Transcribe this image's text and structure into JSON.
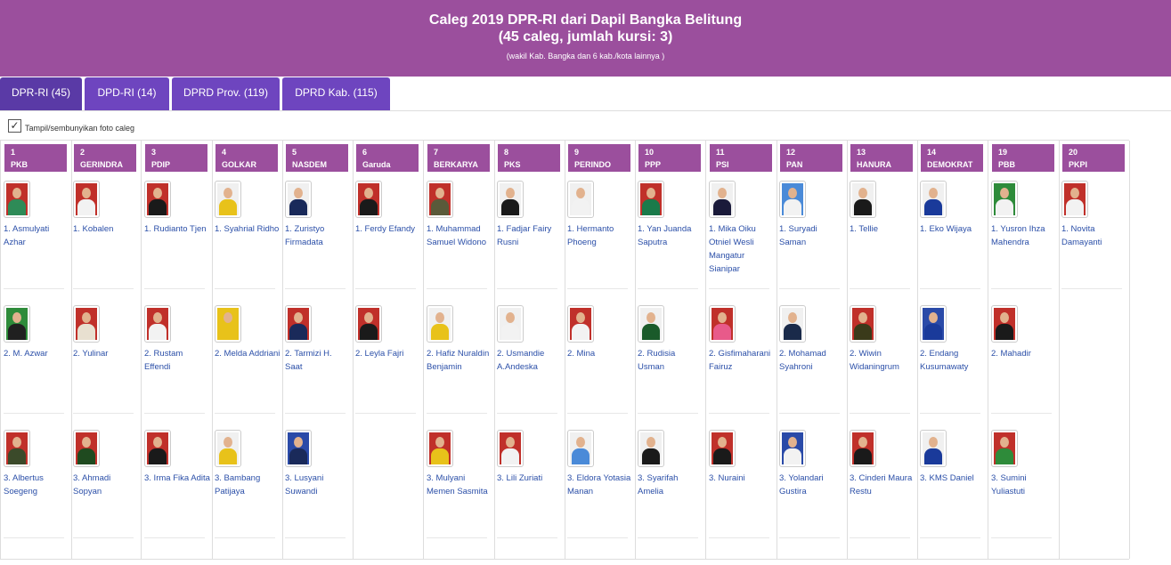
{
  "header": {
    "title_line1": "Caleg 2019 DPR-RI dari Dapil Bangka Belitung",
    "title_line2": "(45 caleg, jumlah kursi: 3)",
    "subtitle": "(wakil Kab. Bangka dan 6 kab./kota lainnya )",
    "bg_color": "#9b4f9d"
  },
  "tabs": [
    {
      "label": "DPR-RI (45)",
      "active": true
    },
    {
      "label": "DPD-RI (14)",
      "active": false
    },
    {
      "label": "DPRD Prov. (119)",
      "active": false
    },
    {
      "label": "DPRD Kab. (115)",
      "active": false
    }
  ],
  "toggle": {
    "label": "Tampil/sembunyikan foto caleg",
    "checked": true,
    "check_glyph": "✓"
  },
  "colors": {
    "party_header": "#9b4f9d",
    "tab": "#6e45bf",
    "link": "#2b4fa8"
  },
  "parties": [
    {
      "num": "1",
      "name": "PKB",
      "candidates": [
        {
          "name": "1. Asmulyati Azhar",
          "photo_bg": "#c0302a",
          "attire": "#2e8b57"
        },
        {
          "name": "2. M. Azwar",
          "photo_bg": "#2e8b3a",
          "attire": "#202020"
        },
        {
          "name": "3. Albertus Soegeng",
          "photo_bg": "#c0302a",
          "attire": "#3b4a2a"
        }
      ]
    },
    {
      "num": "2",
      "name": "GERINDRA",
      "candidates": [
        {
          "name": "1. Kobalen",
          "photo_bg": "#c0302a",
          "attire": "#f2f2f2"
        },
        {
          "name": "2. Yulinar",
          "photo_bg": "#c0302a",
          "attire": "#e8e0d0"
        },
        {
          "name": "3. Ahmadi Sopyan",
          "photo_bg": "#c0302a",
          "attire": "#1f4a1f"
        }
      ]
    },
    {
      "num": "3",
      "name": "PDIP",
      "candidates": [
        {
          "name": "1. Rudianto Tjen",
          "photo_bg": "#c0302a",
          "attire": "#1a1a1a"
        },
        {
          "name": "2. Rustam Effendi",
          "photo_bg": "#c0302a",
          "attire": "#f2f2f2"
        },
        {
          "name": "3. Irma Fika Adita",
          "photo_bg": "#c0302a",
          "attire": "#1a1a1a"
        }
      ]
    },
    {
      "num": "4",
      "name": "GOLKAR",
      "candidates": [
        {
          "name": "1. Syahrial Ridho",
          "photo_bg": "#f0f0f0",
          "attire": "#e8c21a"
        },
        {
          "name": "2. Melda Addriani",
          "photo_bg": "#e8c21a",
          "attire": "#e8c21a"
        },
        {
          "name": "3. Bambang Patijaya",
          "photo_bg": "#f0f0f0",
          "attire": "#e8c21a"
        }
      ]
    },
    {
      "num": "5",
      "name": "NASDEM",
      "candidates": [
        {
          "name": "1. Zuristyo Firmadata",
          "photo_bg": "#f0f0f0",
          "attire": "#1a2a5a"
        },
        {
          "name": "2. Tarmizi H. Saat",
          "photo_bg": "#c0302a",
          "attire": "#1a2a5a"
        },
        {
          "name": "3. Lusyani Suwandi",
          "photo_bg": "#2a4aa8",
          "attire": "#1a2a5a"
        }
      ]
    },
    {
      "num": "6",
      "name": "Garuda",
      "candidates": [
        {
          "name": "1. Ferdy Efandy",
          "photo_bg": "#c0302a",
          "attire": "#1a1a1a"
        },
        {
          "name": "2. Leyla Fajri",
          "photo_bg": "#c0302a",
          "attire": "#1a1a1a"
        }
      ]
    },
    {
      "num": "7",
      "name": "BERKARYA",
      "candidates": [
        {
          "name": "1. Muhammad Samuel Widono",
          "photo_bg": "#c0302a",
          "attire": "#5a5a3a"
        },
        {
          "name": "2. Hafiz Nuraldin Benjamin",
          "photo_bg": "#f0f0f0",
          "attire": "#e8c21a"
        },
        {
          "name": "3. Mulyani Memen Sasmita",
          "photo_bg": "#c0302a",
          "attire": "#e8c21a"
        }
      ]
    },
    {
      "num": "8",
      "name": "PKS",
      "candidates": [
        {
          "name": "1. Fadjar Fairy Rusni",
          "photo_bg": "#f0f0f0",
          "attire": "#1a1a1a"
        },
        {
          "name": "2. Usmandie A.Andeska",
          "photo_bg": "#f0f0f0",
          "attire": "#f2f2f2"
        },
        {
          "name": "3. Lili Zuriati",
          "photo_bg": "#c0302a",
          "attire": "#f2f2f2"
        }
      ]
    },
    {
      "num": "9",
      "name": "PERINDO",
      "candidates": [
        {
          "name": "1. Hermanto Phoeng",
          "photo_bg": "#f0f0f0",
          "attire": "#f2f2f2"
        },
        {
          "name": "2. Mina",
          "photo_bg": "#c0302a",
          "attire": "#f2f2f2"
        },
        {
          "name": "3. Eldora Yotasia Manan",
          "photo_bg": "#f0f0f0",
          "attire": "#4a8ad8"
        }
      ]
    },
    {
      "num": "10",
      "name": "PPP",
      "candidates": [
        {
          "name": "1. Yan Juanda Saputra",
          "photo_bg": "#c0302a",
          "attire": "#1a7a4a"
        },
        {
          "name": "2. Rudisia Usman",
          "photo_bg": "#f0f0f0",
          "attire": "#1a5a2a"
        },
        {
          "name": "3. Syarifah Amelia",
          "photo_bg": "#f0f0f0",
          "attire": "#1a1a1a"
        }
      ]
    },
    {
      "num": "11",
      "name": "PSI",
      "candidates": [
        {
          "name": "1. Mika Oiku Otniel Wesli Mangatur Sianipar",
          "photo_bg": "#f0f0f0",
          "attire": "#1a1a3a"
        },
        {
          "name": "2. Gisfimaharani Fairuz",
          "photo_bg": "#c0302a",
          "attire": "#e85a8a"
        },
        {
          "name": "3. Nuraini",
          "photo_bg": "#c0302a",
          "attire": "#1a1a1a"
        }
      ]
    },
    {
      "num": "12",
      "name": "PAN",
      "candidates": [
        {
          "name": "1. Suryadi Saman",
          "photo_bg": "#4a8ad8",
          "attire": "#f2f2f2"
        },
        {
          "name": "2. Mohamad Syahroni",
          "photo_bg": "#f0f0f0",
          "attire": "#1a2a4a"
        },
        {
          "name": "3. Yolandari Gustira",
          "photo_bg": "#2a4aa8",
          "attire": "#f2f2f2"
        }
      ]
    },
    {
      "num": "13",
      "name": "HANURA",
      "candidates": [
        {
          "name": "1. Tellie",
          "photo_bg": "#f0f0f0",
          "attire": "#1a1a1a"
        },
        {
          "name": "2. Wiwin Widaningrum",
          "photo_bg": "#c0302a",
          "attire": "#3a3a1a"
        },
        {
          "name": "3. Cinderi Maura Restu",
          "photo_bg": "#c0302a",
          "attire": "#1a1a1a"
        }
      ]
    },
    {
      "num": "14",
      "name": "DEMOKRAT",
      "candidates": [
        {
          "name": "1. Eko Wijaya",
          "photo_bg": "#f0f0f0",
          "attire": "#1a3a9a"
        },
        {
          "name": "2. Endang Kusumawaty",
          "photo_bg": "#2a4aa8",
          "attire": "#1a3a9a"
        },
        {
          "name": "3. KMS Daniel",
          "photo_bg": "#f0f0f0",
          "attire": "#1a3a9a"
        }
      ]
    },
    {
      "num": "19",
      "name": "PBB",
      "candidates": [
        {
          "name": "1. Yusron Ihza Mahendra",
          "photo_bg": "#2e8b3a",
          "attire": "#f2f2f2"
        },
        {
          "name": "2. Mahadir",
          "photo_bg": "#c0302a",
          "attire": "#1a1a1a"
        },
        {
          "name": "3. Sumini Yuliastuti",
          "photo_bg": "#c0302a",
          "attire": "#2e8b3a"
        }
      ]
    },
    {
      "num": "20",
      "name": "PKPI",
      "candidates": [
        {
          "name": "1. Novita Damayanti",
          "photo_bg": "#c0302a",
          "attire": "#f2f2f2"
        }
      ]
    }
  ]
}
